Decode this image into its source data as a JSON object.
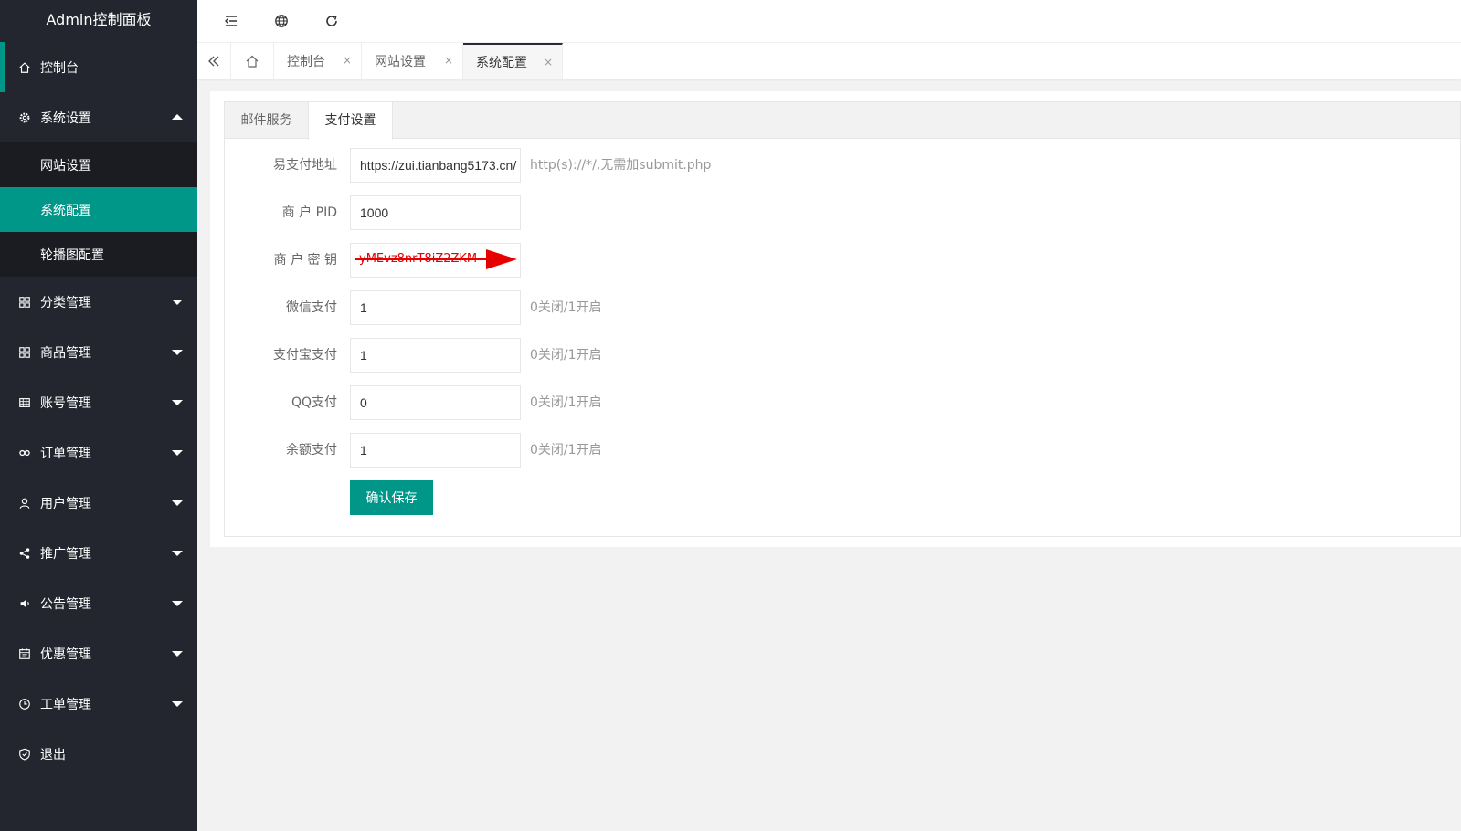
{
  "app": {
    "title": "Admin控制面板"
  },
  "sidebar": {
    "items": [
      {
        "label": "控制台",
        "icon": "home-icon"
      },
      {
        "label": "系统设置",
        "icon": "gear-icon",
        "expanded": true,
        "children": [
          {
            "label": "网站设置"
          },
          {
            "label": "系统配置",
            "selected": true
          },
          {
            "label": "轮播图配置"
          }
        ]
      },
      {
        "label": "分类管理",
        "icon": "apps-icon"
      },
      {
        "label": "商品管理",
        "icon": "apps-icon"
      },
      {
        "label": "账号管理",
        "icon": "table-icon"
      },
      {
        "label": "订单管理",
        "icon": "link-icon"
      },
      {
        "label": "用户管理",
        "icon": "user-icon"
      },
      {
        "label": "推广管理",
        "icon": "share-icon"
      },
      {
        "label": "公告管理",
        "icon": "speaker-icon"
      },
      {
        "label": "优惠管理",
        "icon": "calendar-icon"
      },
      {
        "label": "工单管理",
        "icon": "clock-icon"
      },
      {
        "label": "退出",
        "icon": "shield-icon"
      }
    ]
  },
  "header": {
    "icons": [
      "menu-shrink-icon",
      "globe-icon",
      "refresh-icon"
    ]
  },
  "tabs": {
    "items": [
      {
        "label": "控制台"
      },
      {
        "label": "网站设置"
      },
      {
        "label": "系统配置",
        "active": true
      }
    ],
    "close_glyph": "×"
  },
  "content": {
    "tabs": [
      {
        "label": "邮件服务"
      },
      {
        "label": "支付设置",
        "active": true
      }
    ],
    "form": {
      "epay_url": {
        "label": "易支付地址",
        "value": "https://zui.tianbang5173.cn/",
        "hint": "http(s)://*/,无需加submit.php"
      },
      "merchant_pid": {
        "label": "商 户 PID",
        "value": "1000"
      },
      "merchant_key": {
        "label": "商 户 密 钥",
        "value": "yMEvz8nrT8iZ2ZKM"
      },
      "wechat_pay": {
        "label": "微信支付",
        "value": "1",
        "hint": "0关闭/1开启"
      },
      "alipay": {
        "label": "支付宝支付",
        "value": "1",
        "hint": "0关闭/1开启"
      },
      "qq_pay": {
        "label": "QQ支付",
        "value": "0",
        "hint": "0关闭/1开启"
      },
      "balance_pay": {
        "label": "余额支付",
        "value": "1",
        "hint": "0关闭/1开启"
      },
      "submit_label": "确认保存"
    }
  },
  "colors": {
    "accent": "#009688",
    "sidebar_bg": "#23262e",
    "annotation": "#e60000"
  }
}
